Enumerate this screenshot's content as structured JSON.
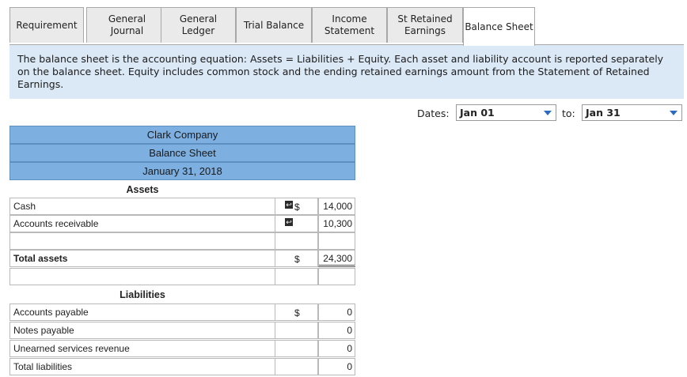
{
  "tabs": [
    {
      "label": "Requirement",
      "active": false
    },
    {
      "label": "General\nJournal",
      "active": false
    },
    {
      "label": "General\nLedger",
      "active": false
    },
    {
      "label": "Trial Balance",
      "active": false
    },
    {
      "label": "Income\nStatement",
      "active": false
    },
    {
      "label": "St Retained\nEarnings",
      "active": false
    },
    {
      "label": "Balance Sheet",
      "active": true
    }
  ],
  "banner": {
    "text": "The balance sheet is the accounting equation:  Assets = Liabilities + Equity. Each asset and liability account is reported separately on the balance sheet. Equity includes common stock and the ending retained earnings amount from the Statement of Retained Earnings."
  },
  "dates": {
    "from_label": "Dates:",
    "from_value": "Jan 01",
    "to_label": "to:",
    "to_value": "Jan 31"
  },
  "sheet": {
    "company": "Clark Company",
    "title": "Balance Sheet",
    "date": "January 31, 2018",
    "assets_heading": "Assets",
    "cash_label": "Cash",
    "cash_dollar": "$",
    "cash_amount": "14,000",
    "ar_label": "Accounts receivable",
    "ar_amount": "10,300",
    "total_assets_label": "Total assets",
    "total_assets_dollar": "$",
    "total_assets_amount": "24,300",
    "liabilities_heading": "Liabilities",
    "ap_label": "Accounts payable",
    "ap_dollar": "$",
    "ap_amount": "0",
    "np_label": "Notes payable",
    "np_amount": "0",
    "usr_label": "Unearned services revenue",
    "usr_amount": "0",
    "tl_label": "Total liabilities",
    "tl_amount": "0"
  },
  "colors": {
    "header_blue": "#7dafe0",
    "banner_blue": "#dbe8f5",
    "dropdown_arrow": "#2a6cbf"
  }
}
